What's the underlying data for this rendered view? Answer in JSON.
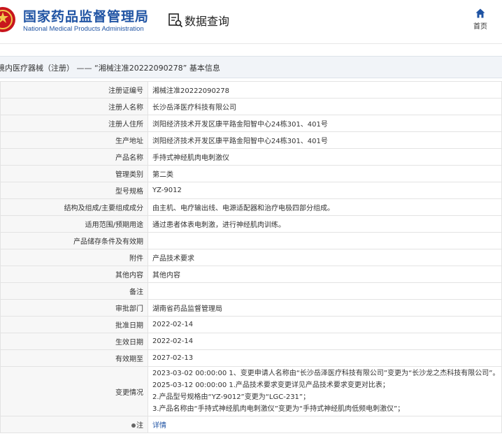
{
  "header": {
    "brand_cn": "国家药品监督管理局",
    "brand_en": "National Medical Products Administration",
    "query_title": "数据查询",
    "home_label": "首页"
  },
  "detail_title": "境内医疗器械（注册） —— “湘械注准20222090278” 基本信息",
  "rows": [
    {
      "label": "注册证编号",
      "value": "湘械注准20222090278"
    },
    {
      "label": "注册人名称",
      "value": "长沙岳泽医疗科技有限公司"
    },
    {
      "label": "注册人住所",
      "value": "浏阳经济技术开发区康平路金阳智中心24栋301、401号"
    },
    {
      "label": "生产地址",
      "value": "浏阳经济技术开发区康平路金阳智中心24栋301、401号"
    },
    {
      "label": "产品名称",
      "value": "手持式神经肌肉电刺激仪"
    },
    {
      "label": "管理类别",
      "value": "第二类"
    },
    {
      "label": "型号规格",
      "value": "YZ-9012"
    },
    {
      "label": "结构及组成/主要组成成分",
      "value": "由主机、电疗输出线、电源适配器和治疗电极四部分组成。"
    },
    {
      "label": "适用范围/预期用途",
      "value": "通过患者体表电刺激，进行神经肌肉训练。"
    },
    {
      "label": "产品储存条件及有效期",
      "value": ""
    },
    {
      "label": "附件",
      "value": "产品技术要求"
    },
    {
      "label": "其他内容",
      "value": "其他内容"
    },
    {
      "label": "备注",
      "value": ""
    },
    {
      "label": "审批部门",
      "value": "湖南省药品监督管理局"
    },
    {
      "label": "批准日期",
      "value": "2022-02-14"
    },
    {
      "label": "生效日期",
      "value": "2022-02-14"
    },
    {
      "label": "有效期至",
      "value": "2027-02-13"
    }
  ],
  "change": {
    "label": "变更情况",
    "lines": [
      "2023-03-02 00:00:00 1、变更申请人名称由“长沙岳泽医疗科技有限公司”变更为“长沙龙之杰科技有限公司”。",
      "2025-03-12 00:00:00 1.产品技术要求变更详见产品技术要求变更对比表；",
      "2.产品型号规格由“YZ-9012”变更为“LGC-231”；",
      "3.产品名称由“手持式神经肌肉电刺激仪”变更为“手持式神经肌肉低频电刺激仪”；"
    ]
  },
  "note": {
    "label": "注",
    "link": "详情"
  },
  "colors": {
    "brand": "#1f53a3",
    "label_bg": "#f7f7f7",
    "title_bar_bg": "#f1f4f8"
  }
}
